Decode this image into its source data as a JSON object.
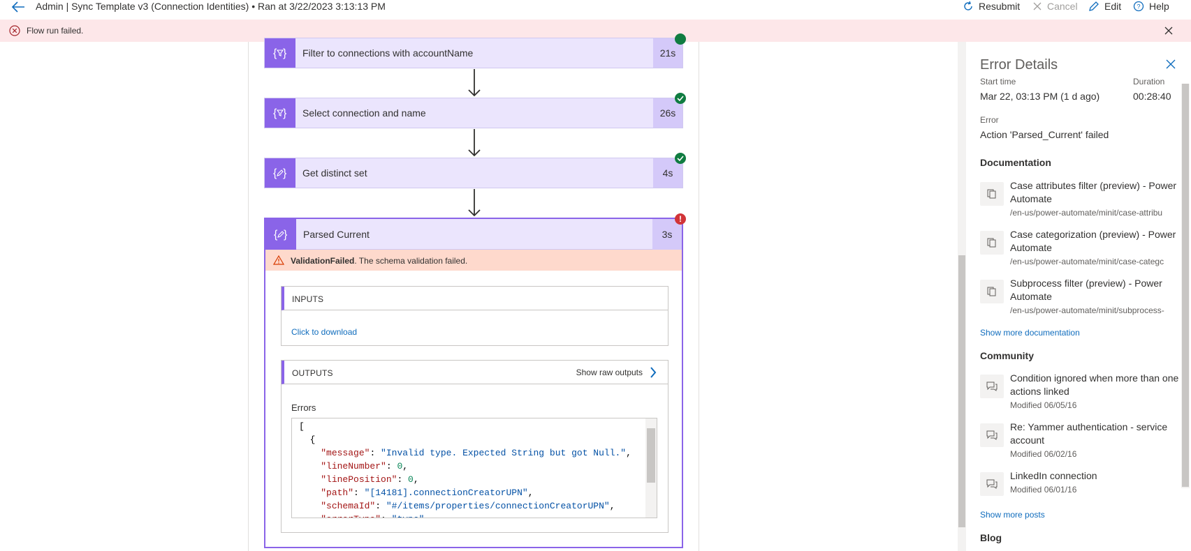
{
  "header": {
    "title": "Admin | Sync Template v3 (Connection Identities) • Ran at 3/22/2023 3:13:13 PM",
    "resubmit": "Resubmit",
    "cancel": "Cancel",
    "edit": "Edit",
    "help": "Help"
  },
  "banner": {
    "message": "Flow run failed."
  },
  "steps": [
    {
      "label": "Filter to connections with accountName",
      "duration": "21s",
      "status": "succeeded"
    },
    {
      "label": "Select connection and name",
      "duration": "26s",
      "status": "succeeded"
    },
    {
      "label": "Get distinct set",
      "duration": "4s",
      "status": "succeeded"
    },
    {
      "label": "Parsed Current",
      "duration": "3s",
      "status": "failed"
    }
  ],
  "failed_step": {
    "error_code": "ValidationFailed",
    "error_text": ". The schema validation failed.",
    "inputs_title": "INPUTS",
    "inputs_link": "Click to download",
    "outputs_title": "OUTPUTS",
    "show_raw_outputs": "Show raw outputs",
    "errors_label": "Errors"
  },
  "panel": {
    "title": "Error Details",
    "start_time_label": "Start time",
    "start_time": "Mar 22, 03:13 PM (1 d ago)",
    "duration_label": "Duration",
    "duration": "00:28:40",
    "error_label": "Error",
    "error_value": "Action 'Parsed_Current' failed",
    "documentation_heading": "Documentation",
    "docs": [
      {
        "title": "Case attributes filter (preview) - Power Automate",
        "url": "/en-us/power-automate/minit/case-attribu"
      },
      {
        "title": "Case categorization (preview) - Power Automate",
        "url": "/en-us/power-automate/minit/case-categc"
      },
      {
        "title": "Subprocess filter (preview) - Power Automate",
        "url": "/en-us/power-automate/minit/subprocess-"
      }
    ],
    "show_more_docs": "Show more documentation",
    "community_heading": "Community",
    "posts": [
      {
        "title": "Condition ignored when more than one actions linked",
        "modified": "Modified 06/05/16"
      },
      {
        "title": "Re: Yammer authentication - service account",
        "modified": "Modified 06/02/16"
      },
      {
        "title": "LinkedIn connection",
        "modified": "Modified 06/01/16"
      }
    ],
    "show_more_posts": "Show more posts",
    "blog_heading": "Blog"
  }
}
